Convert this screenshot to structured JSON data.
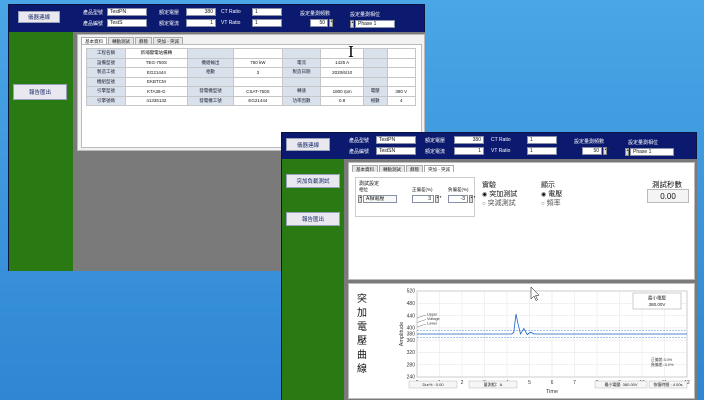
{
  "win1": {
    "header": {
      "connect_btn": "儀器連線",
      "model_label": "產品型號",
      "model_value": "TestPN",
      "serial_label": "產品編號",
      "serial_value": "TestS",
      "rated_v_label": "額定電壓",
      "rated_v_value": "380",
      "rated_i_label": "額定電流",
      "rated_i_value": "1",
      "ct_label": "CT Ratio",
      "ct_value": "1",
      "vt_label": "VT Ratio",
      "vt_value": "1",
      "freq_label": "設定量測頻數",
      "freq_value": "50",
      "phase_label": "設定量測相位",
      "phase_value": "Phase 1"
    },
    "side": {
      "export_btn": "報告匯出"
    },
    "tabs": [
      "基本資料",
      "轉動測試",
      "靜態",
      "突加 - 突減"
    ],
    "table": [
      [
        "工程名稱",
        "新埔變電站備轉",
        "",
        "",
        "",
        "",
        "",
        ""
      ],
      [
        "設備型號",
        "TEG-750S",
        "機組輸出",
        "750 kW",
        "電流",
        "1425 A",
        "",
        ""
      ],
      [
        "製造工號",
        "EG21444",
        "相數",
        "3",
        "製造日期",
        "2020/6/10",
        "",
        ""
      ],
      [
        "機組型號",
        "EKBTCM",
        "",
        "",
        "",
        "",
        "",
        ""
      ],
      [
        "引擎型號",
        "KTA38-G",
        "發電機型號",
        "CSAT-750S",
        "轉速",
        "1800 rpm",
        "電壓",
        "380 V"
      ],
      [
        "引擎號碼",
        "41335132",
        "發電機工號",
        "EG21444",
        "功率因數",
        "0.8",
        "極數",
        "4"
      ]
    ]
  },
  "win2": {
    "header": {
      "connect_btn": "儀器連線",
      "model_label": "產品型號",
      "model_value": "TestPN",
      "serial_label": "產品編號",
      "serial_value": "TestSN",
      "rated_v_label": "額定電壓",
      "rated_v_value": "380",
      "rated_i_label": "額定電流",
      "rated_i_value": "1",
      "ct_label": "CT Ratio",
      "ct_value": "1",
      "vt_label": "VT Ratio",
      "vt_value": "1",
      "freq_label": "設定量測頻數",
      "freq_value": "50",
      "phase_label": "設定量測相位",
      "phase_value": "Phase 1"
    },
    "side": {
      "sudden_btn": "突加負載測試",
      "export_btn": "報告匯出"
    },
    "tabs": [
      "基本資料",
      "轉動測試",
      "靜態",
      "突加 - 突減"
    ],
    "panel": {
      "group_title": "測試設定",
      "col_phase": "相位",
      "col_upper": "正偏差(%)",
      "col_lower": "負偏差(%)",
      "phase_value": "A相電壓",
      "upper_value": "3",
      "lower_value": "-3",
      "exp_title": "實驗",
      "exp_opt1": "突加測試",
      "exp_opt2": "突減測試",
      "disp_title": "顯示",
      "disp_opt1": "電壓",
      "disp_opt2": "頻率",
      "sec_title": "測試秒數",
      "sec_value": "0.00"
    },
    "chart_title": "突加電壓曲線",
    "chart_data": {
      "type": "line",
      "ylabel": "Amplitude",
      "xlabel": "Time",
      "xlim": [
        0,
        12
      ],
      "ylim": [
        240,
        520
      ],
      "xticks": [
        0,
        1,
        2,
        3,
        4,
        5,
        6,
        7,
        8,
        9,
        10,
        11,
        12
      ],
      "yticks": [
        240,
        280,
        320,
        360,
        380,
        400,
        440,
        480,
        520
      ],
      "legend_labels": [
        "Upper",
        "Voltage",
        "Lower"
      ],
      "annot_min_label": "最小電壓",
      "annot_min_value": "380.00V",
      "annot_pos": "正偏差:3.0%",
      "annot_neg": "負偏差:-3.0%",
      "status_left": "Dur% : 0.00",
      "status_mid": "量測相：A",
      "status_min": "最小電壓: 380.00V",
      "status_stable": "恢復時間 : 4.00s",
      "series": [
        {
          "name": "Upper",
          "color": "#4a8de0",
          "x": [
            0,
            12
          ],
          "y": [
            391.4,
            391.4
          ]
        },
        {
          "name": "Voltage",
          "color": "#1e64c8",
          "x": [
            0,
            4.2,
            4.3,
            4.4,
            4.5,
            4.6,
            4.75,
            4.9,
            5.05,
            5.2,
            5.4,
            12
          ],
          "y": [
            380,
            380,
            385,
            445,
            410,
            380,
            398,
            378,
            386,
            380,
            380,
            380
          ]
        },
        {
          "name": "Lower",
          "color": "#4a8de0",
          "x": [
            0,
            12
          ],
          "y": [
            368.6,
            368.6
          ]
        }
      ]
    }
  }
}
